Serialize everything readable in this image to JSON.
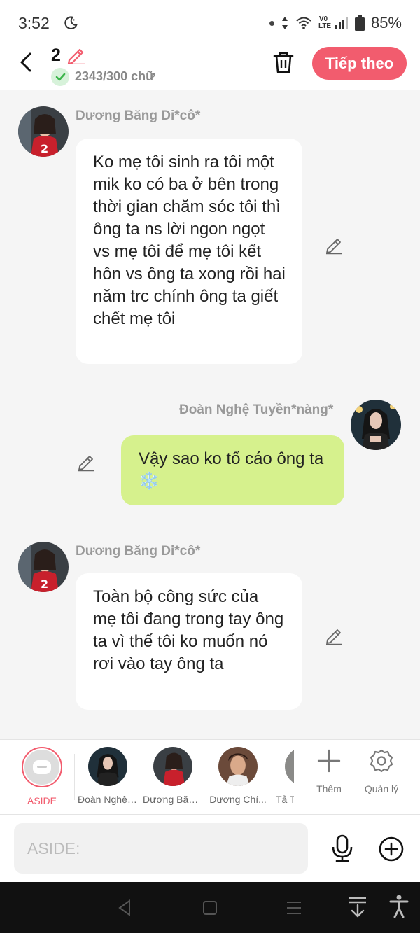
{
  "status_bar": {
    "time": "3:52",
    "battery": "85%"
  },
  "header": {
    "count": "2",
    "word_count": "2343/300 chữ",
    "next_label": "Tiếp theo"
  },
  "messages": [
    {
      "sender": "Dương Băng Di*cô*",
      "side": "left",
      "text": "Ko mẹ tôi sinh ra tôi một mik ko có ba ở bên trong thời gian chăm sóc tôi thì ông ta ns lời ngon ngọt vs mẹ tôi để mẹ tôi kết hôn vs ông ta xong rồi hai năm trc chính ông ta giết chết mẹ tôi"
    },
    {
      "sender": "Đoàn Nghệ Tuyền*nàng*",
      "side": "right",
      "text": "Vậy sao ko tố cáo ông ta ❄️"
    },
    {
      "sender": "Dương Băng Di*cô*",
      "side": "left",
      "text": "Toàn bộ công sức của mẹ tôi đang trong tay ông ta vì thế tôi ko muốn nó rơi vào tay ông ta"
    }
  ],
  "character_bar": {
    "aside_label": "ASIDE",
    "characters": [
      {
        "label": "Đoàn Nghệ Tuyền*nàng*"
      },
      {
        "label": "Dương Băng Di*cô*"
      },
      {
        "label": "Dương Chí..."
      },
      {
        "label": "Tả T"
      }
    ],
    "add_label": "Thêm",
    "manage_label": "Quản lý"
  },
  "input": {
    "placeholder": "ASIDE:"
  },
  "colors": {
    "accent": "#f25c6e",
    "right_bubble": "#d6f18d"
  }
}
